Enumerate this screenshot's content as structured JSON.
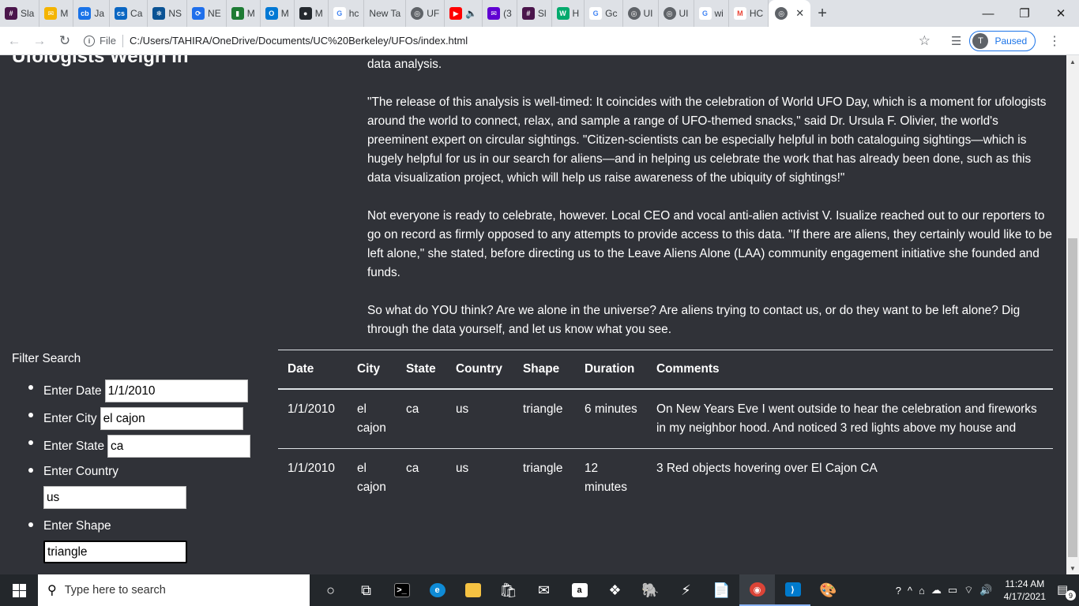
{
  "browser": {
    "tabs": [
      {
        "label": "Sla",
        "icon": "slack-icon",
        "color": "#4a154b"
      },
      {
        "label": "M",
        "icon": "mail-icon",
        "color": "#f4b400"
      },
      {
        "label": "Ja",
        "icon": "cb-icon",
        "color": "#1a73e8"
      },
      {
        "label": "Ca",
        "icon": "cs-icon",
        "color": "#0a66c2"
      },
      {
        "label": "NS",
        "icon": "snowflake-icon",
        "color": "#0b5394"
      },
      {
        "label": "NE",
        "icon": "sync-icon",
        "color": "#1f6feb"
      },
      {
        "label": "M",
        "icon": "doc-icon",
        "color": "#1e7b34"
      },
      {
        "label": "M",
        "icon": "outlook-icon",
        "color": "#0078d4"
      },
      {
        "label": "M",
        "icon": "github-icon",
        "color": "#24292e"
      },
      {
        "label": "hc",
        "icon": "google-icon",
        "color": "#ffffff"
      },
      {
        "label": "New Ta",
        "icon": "",
        "color": ""
      },
      {
        "label": "UF",
        "icon": "globe-icon",
        "color": "#5f6368"
      },
      {
        "label": "",
        "icon": "youtube-icon",
        "color": "#ff0000"
      },
      {
        "label": "(3",
        "icon": "yahoo-mail-icon",
        "color": "#6001d2"
      },
      {
        "label": "Sl",
        "icon": "slack-icon",
        "color": "#4a154b"
      },
      {
        "label": "H",
        "icon": "w3-icon",
        "color": "#04aa6d"
      },
      {
        "label": "Gc",
        "icon": "google-icon",
        "color": "#ffffff"
      },
      {
        "label": "UI",
        "icon": "globe-icon",
        "color": "#5f6368"
      },
      {
        "label": "UI",
        "icon": "globe-icon",
        "color": "#5f6368"
      },
      {
        "label": "wi",
        "icon": "google-icon",
        "color": "#ffffff"
      },
      {
        "label": "HC",
        "icon": "gmail-icon",
        "color": "#ea4335"
      }
    ],
    "address": {
      "scheme_label": "File",
      "url": "C:/Users/TAHIRA/OneDrive/Documents/UC%20Berkeley/UFOs/index.html"
    },
    "profile": {
      "initial": "T",
      "status": "Paused"
    }
  },
  "page": {
    "heading_fragment": "Ufologists Weigh In",
    "article": [
      "data analysis.",
      "\"The release of this analysis is well-timed: It coincides with the celebration of World UFO Day, which is a moment for ufologists around the world to connect, relax, and sample a range of UFO-themed snacks,\" said Dr. Ursula F. Olivier, the world's preeminent expert on circular sightings. \"Citizen-scientists can be especially helpful in both cataloguing sightings—which is hugely helpful for us in our search for aliens—and in helping us celebrate the work that has already been done, such as this data visualization project, which will help us raise awareness of the ubiquity of sightings!\"",
      "Not everyone is ready to celebrate, however. Local CEO and vocal anti-alien activist V. Isualize reached out to our reporters to go on record as firmly opposed to any attempts to provide access to this data. \"If there are aliens, they certainly would like to be left alone,\" she stated, before directing us to the Leave Aliens Alone (LAA) community engagement initiative she founded and funds.",
      "So what do YOU think? Are we alone in the universe? Are aliens trying to contact us, or do they want to be left alone? Dig through the data yourself, and let us know what you see."
    ],
    "filter": {
      "title": "Filter Search",
      "date": {
        "label": "Enter Date",
        "value": "1/1/2010"
      },
      "city": {
        "label": "Enter City",
        "value": "el cajon"
      },
      "state": {
        "label": "Enter State",
        "value": "ca"
      },
      "country": {
        "label": "Enter Country",
        "value": "us"
      },
      "shape": {
        "label": "Enter Shape",
        "value": "triangle"
      }
    },
    "table": {
      "headers": [
        "Date",
        "City",
        "State",
        "Country",
        "Shape",
        "Duration",
        "Comments"
      ],
      "rows": [
        [
          "1/1/2010",
          "el cajon",
          "ca",
          "us",
          "triangle",
          "6 minutes",
          "On New Years Eve I went outside to hear the celebration and fireworks in my neighbor hood. And noticed 3 red lights above my house and"
        ],
        [
          "1/1/2010",
          "el cajon",
          "ca",
          "us",
          "triangle",
          "12 minutes",
          "3 Red objects hovering over El Cajon CA"
        ]
      ]
    }
  },
  "taskbar": {
    "search_placeholder": "Type here to search",
    "time": "11:24 AM",
    "date": "4/17/2021",
    "notification_count": "9"
  }
}
